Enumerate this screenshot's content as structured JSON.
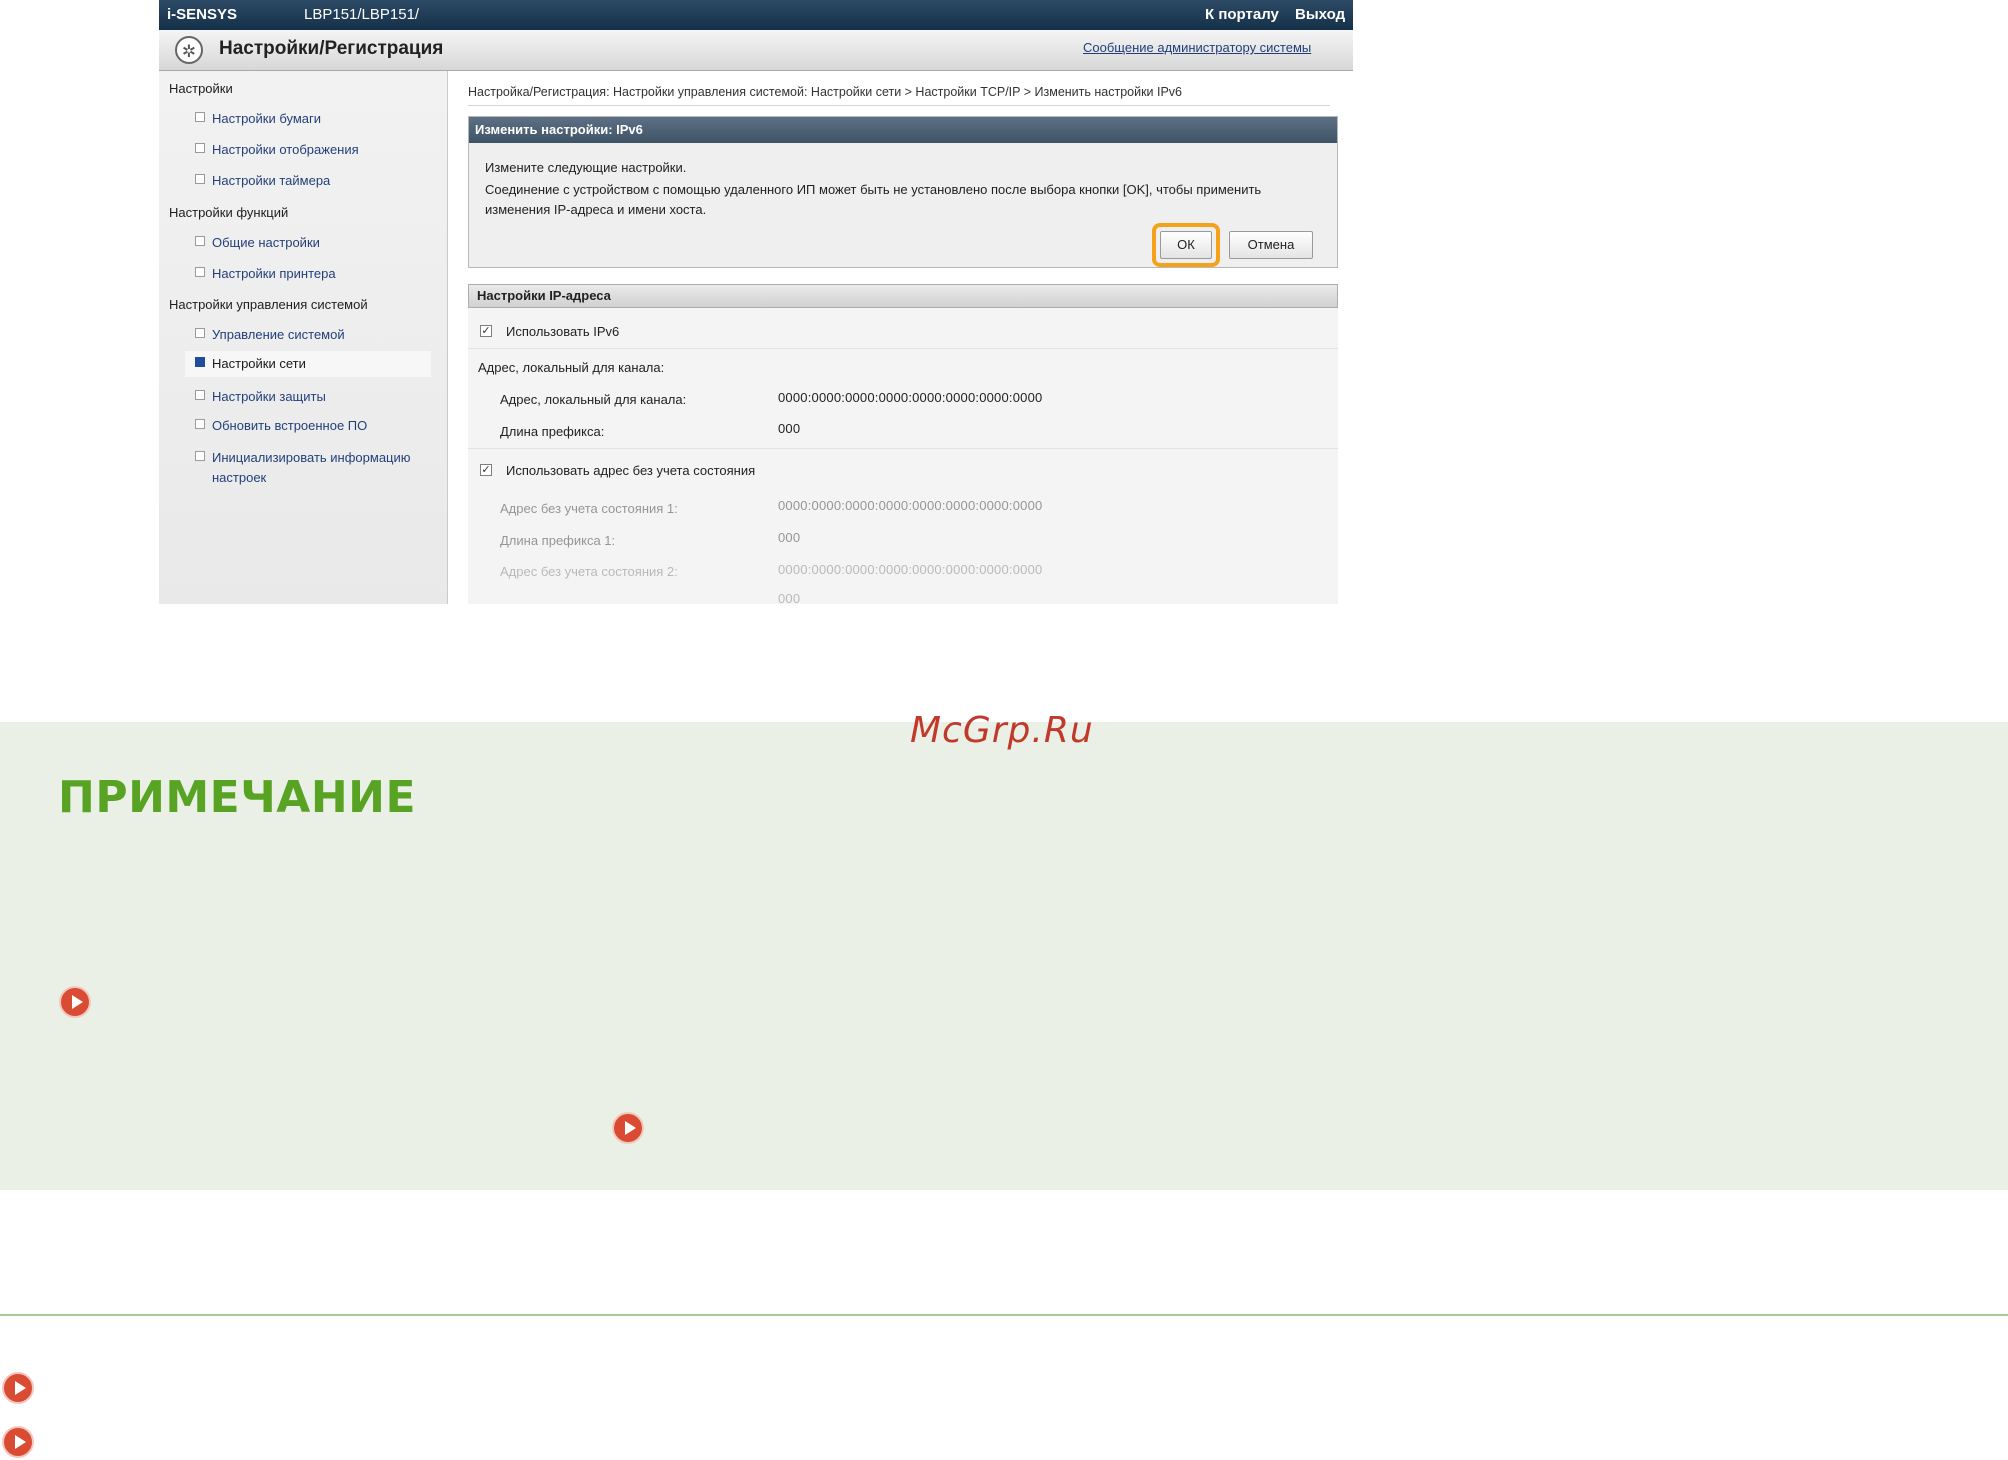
{
  "remote_ui": {
    "brand": "i-SENSYS",
    "model": "LBP151/LBP151/",
    "portal_link": "К порталу",
    "logout_link": "Выход",
    "title": "Настройки/Регистрация",
    "admin_message_link": "Сообщение администратору системы",
    "nav": {
      "group1": "Настройки",
      "group1_items": [
        "Настройки бумаги",
        "Настройки отображения",
        "Настройки таймера"
      ],
      "group2": "Настройки функций",
      "group2_items": [
        "Общие настройки",
        "Настройки принтера"
      ],
      "group3": "Настройки управления системой",
      "group3_items": [
        "Управление системой",
        "Настройки сети",
        "Настройки защиты",
        "Обновить встроенное ПО"
      ],
      "init_item_line1": "Инициализировать информацию",
      "init_item_line2": "настроек"
    },
    "breadcrumb": "Настройка/Регистрация: Настройки управления системой: Настройки сети > Настройки TCP/IP > Изменить настройки IPv6",
    "dialog": {
      "header": "Изменить настройки: IPv6",
      "line1": "Измените следующие настройки.",
      "line2": "Соединение с устройством с помощью удаленного ИП может быть не установлено после выбора кнопки [OK], чтобы применить изменения IP-адреса и имени хоста.",
      "ok_label": "ОК",
      "cancel_label": "Отмена"
    },
    "ip_section": {
      "header": "Настройки IP-адреса",
      "use_ipv6_label": "Использовать IPv6",
      "use_ipv6_checked": true,
      "link_local_heading": "Адрес, локальный для канала:",
      "link_local_label": "Адрес, локальный для канала:",
      "link_local_value": "0000:0000:0000:0000:0000:0000:0000:0000",
      "prefix_label": "Длина префикса:",
      "prefix_value": "000",
      "use_stateless_label": "Использовать адрес без учета состояния",
      "use_stateless_checked": true,
      "stateless1_label": "Адрес без учета состояния 1:",
      "stateless1_value": "0000:0000:0000:0000:0000:0000:0000:0000",
      "prefix1_label": "Длина префикса 1:",
      "prefix1_value": "000",
      "stateless2_label": "Адрес без учета состояния 2:",
      "stateless2_value": "0000:0000:0000:0000:0000:0000:0000:0000",
      "prefix2_value": "000"
    }
  },
  "watermark": "McGrp.Ru",
  "note": {
    "title": "ПРИМЕЧАНИЕ"
  },
  "colors": {
    "note_title": "#58a324",
    "arrow_icon": "#d94c33",
    "ok_highlight": "#f3a21a"
  }
}
